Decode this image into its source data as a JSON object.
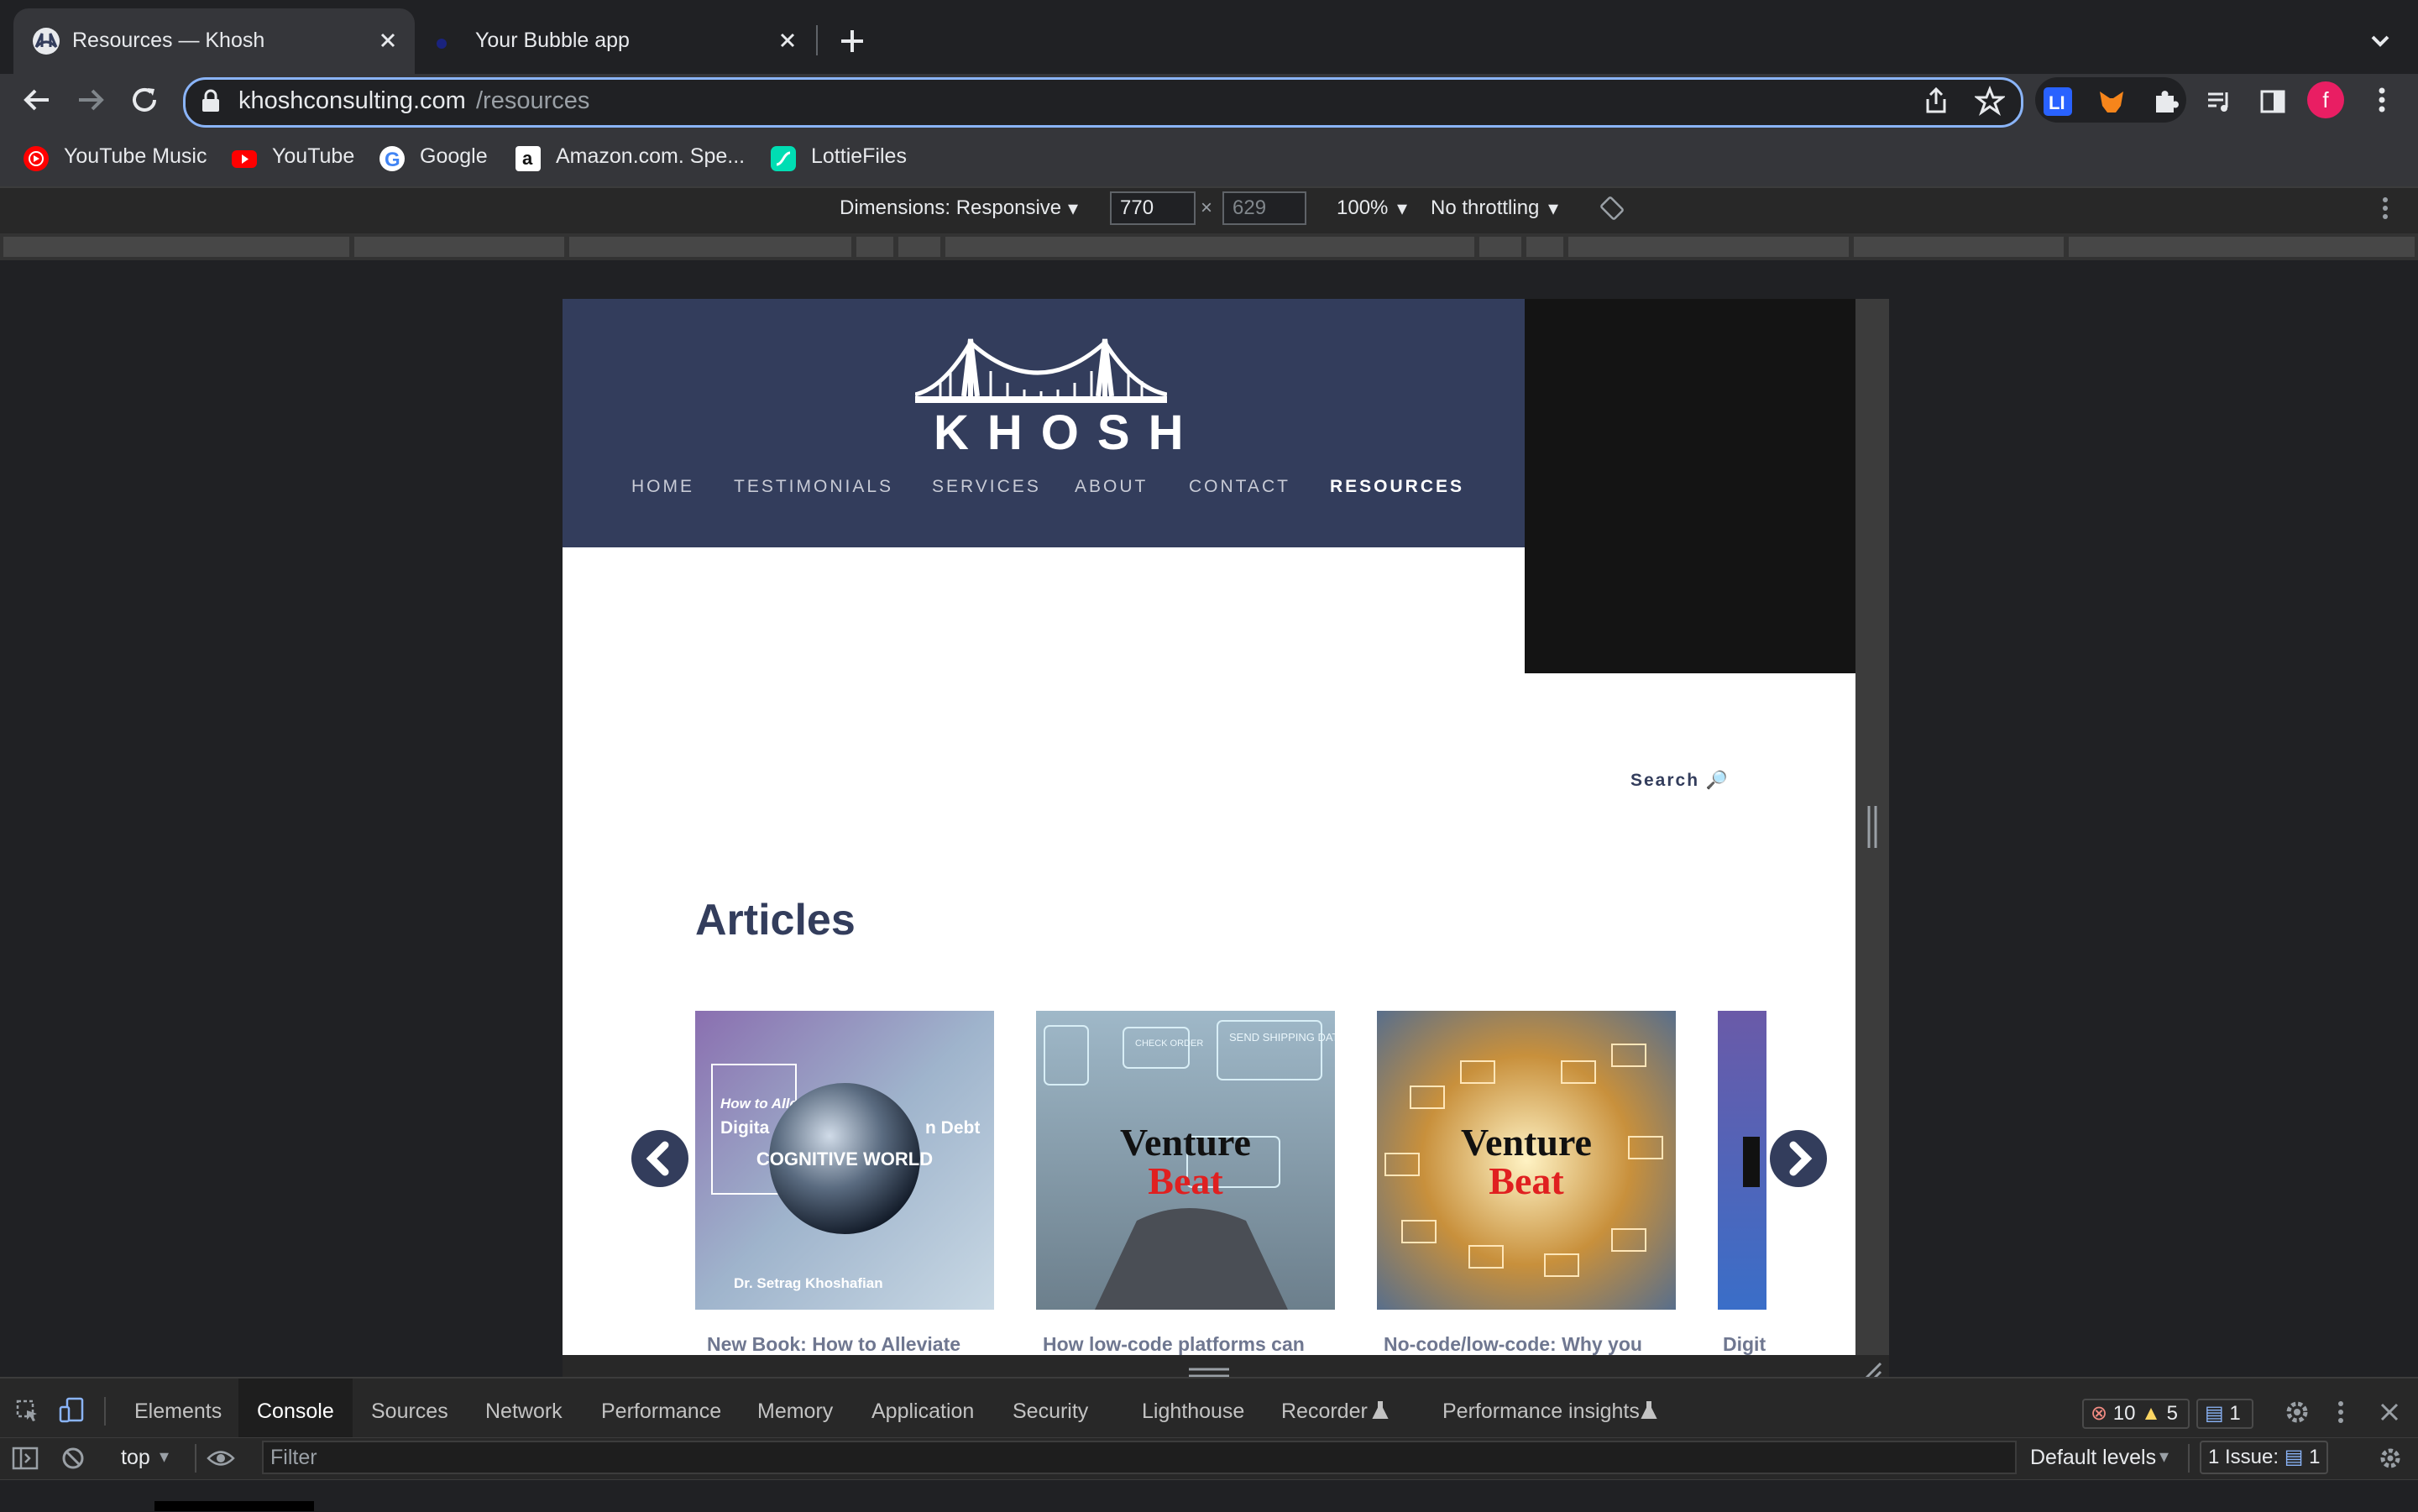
{
  "tabs": [
    {
      "title": "Resources — Khosh",
      "active": true
    },
    {
      "title": "Your Bubble app",
      "active": false
    }
  ],
  "omnibox": {
    "host": "khoshconsulting.com",
    "path": "/resources"
  },
  "avatar_letter": "f",
  "bookmarks": [
    {
      "label": "YouTube Music",
      "icon": "youtube-music-icon"
    },
    {
      "label": "YouTube",
      "icon": "youtube-icon"
    },
    {
      "label": "Google",
      "icon": "google-icon"
    },
    {
      "label": "Amazon.com. Spe...",
      "icon": "amazon-icon"
    },
    {
      "label": "LottieFiles",
      "icon": "lottiefiles-icon"
    }
  ],
  "device_toolbar": {
    "dimensions_label": "Dimensions: Responsive",
    "width": "770",
    "height": "629",
    "zoom": "100%",
    "throttling": "No throttling"
  },
  "site": {
    "logo_text": "KHOSH",
    "nav": [
      "HOME",
      "TESTIMONIALS",
      "SERVICES",
      "ABOUT",
      "CONTACT",
      "RESOURCES"
    ],
    "active_nav": "RESOURCES",
    "search_label": "Search 🔎",
    "articles_heading": "Articles",
    "articles": [
      {
        "title": "New Book: How to Alleviate",
        "card_text": [
          "How to Alle",
          "Digita",
          "n Debt",
          "Dr. Setrag Khoshafian",
          "COGNITIVE WORLD"
        ]
      },
      {
        "title": "How low-code platforms can",
        "card_text": [
          "Venture",
          "Beat",
          "SEND SHIPPING DATA",
          "CHECK ORDER"
        ]
      },
      {
        "title": "No-code/low-code: Why you",
        "card_text": [
          "Venture",
          "Beat"
        ]
      },
      {
        "title": "Digit",
        "card_text": []
      }
    ]
  },
  "devtools": {
    "tabs": [
      "Elements",
      "Console",
      "Sources",
      "Network",
      "Performance",
      "Memory",
      "Application",
      "Security",
      "Lighthouse",
      "Recorder",
      "Performance insights"
    ],
    "active_tab": "Console",
    "errors": "10",
    "warnings": "5",
    "messages": "1",
    "context": "top",
    "filter_placeholder": "Filter",
    "levels": "Default levels",
    "issues_label": "1 Issue:",
    "issues_count": "1"
  },
  "colors": {
    "header_bg": "#333d5c",
    "accent_blue": "#8ab4f8",
    "venturebeat_red": "#e02020",
    "avatar": "#e91e63"
  }
}
